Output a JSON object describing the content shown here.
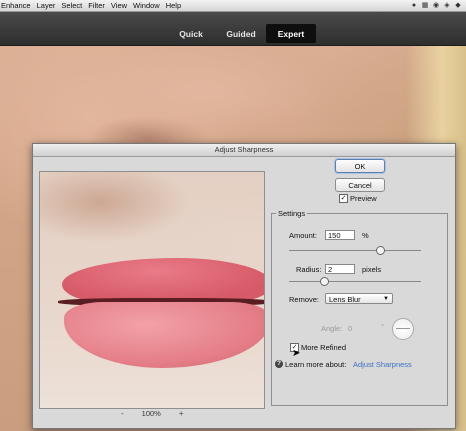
{
  "menubar": {
    "items": [
      "Enhance",
      "Layer",
      "Select",
      "Filter",
      "View",
      "Window",
      "Help"
    ],
    "icons": [
      "app-icon",
      "security-icon",
      "wifi-icon",
      "bluetooth-icon",
      "menu-extra-icon"
    ]
  },
  "modes": {
    "tabs": [
      "Quick",
      "Guided",
      "Expert"
    ],
    "active": "Expert"
  },
  "dialog": {
    "title": "Adjust Sharpness",
    "ok": "OK",
    "cancel": "Cancel",
    "preview_label": "Preview",
    "preview_checked": true,
    "zoom": {
      "minus": "-",
      "value": "100%",
      "plus": "+"
    },
    "settings": {
      "group_label": "Settings",
      "amount_label": "Amount:",
      "amount_value": "150",
      "amount_unit": "%",
      "radius_label": "Radius:",
      "radius_value": "2",
      "radius_unit": "pixels",
      "remove_label": "Remove:",
      "remove_value": "Lens Blur",
      "angle_label": "Angle:",
      "angle_value": "0",
      "angle_unit": "°",
      "more_refined_label": "More Refined",
      "more_refined_checked": true,
      "learn_more_text": "Learn more about:",
      "learn_more_link": "Adjust Sharpness",
      "help_glyph": "?"
    }
  }
}
